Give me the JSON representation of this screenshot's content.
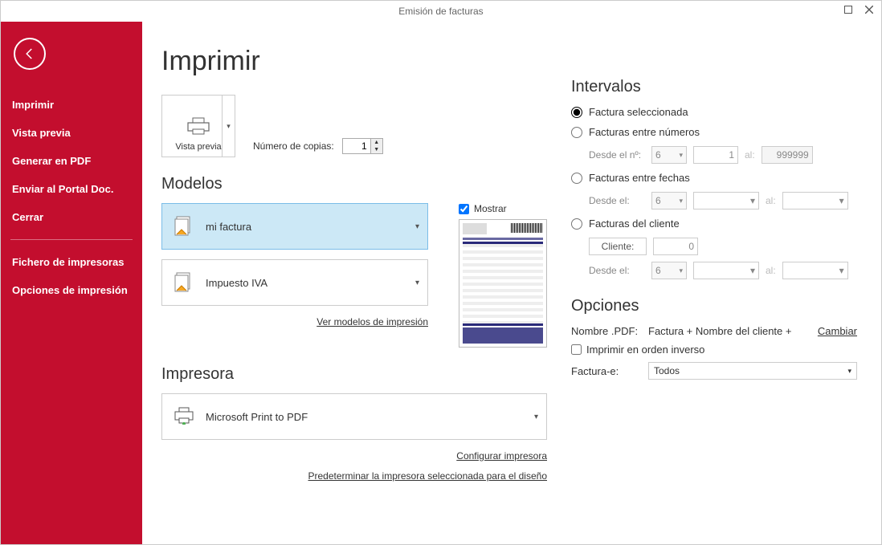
{
  "window": {
    "title": "Emisión de facturas"
  },
  "sidebar": {
    "items": [
      {
        "label": "Imprimir"
      },
      {
        "label": "Vista previa"
      },
      {
        "label": "Generar en PDF"
      },
      {
        "label": "Enviar al Portal Doc."
      },
      {
        "label": "Cerrar"
      }
    ],
    "items2": [
      {
        "label": "Fichero de impresoras"
      },
      {
        "label": "Opciones de impresión"
      }
    ]
  },
  "page": {
    "heading": "Imprimir",
    "vista_previa": "Vista previa",
    "copies_label": "Número de copias:",
    "copies_value": "1"
  },
  "modelos": {
    "heading": "Modelos",
    "show_label": "Mostrar",
    "items": [
      {
        "label": "mi factura"
      },
      {
        "label": "Impuesto IVA"
      }
    ],
    "link": "Ver modelos de impresión"
  },
  "impresora": {
    "heading": "Impresora",
    "item": "Microsoft Print to PDF",
    "link1": "Configurar impresora",
    "link2": "Predeterminar la impresora seleccionada para el diseño"
  },
  "intervalos": {
    "heading": "Intervalos",
    "radios": {
      "selected": "Factura seleccionada",
      "between_numbers": "Facturas entre números",
      "between_dates": "Facturas entre fechas",
      "client": "Facturas del cliente"
    },
    "labels": {
      "from_n": "Desde el nº:",
      "from": "Desde el:",
      "to": "al:",
      "client": "Cliente:"
    },
    "values": {
      "serie": "6",
      "num_from": "1",
      "num_to": "999999",
      "client_id": "0"
    }
  },
  "opciones": {
    "heading": "Opciones",
    "pdf_name_label": "Nombre .PDF:",
    "pdf_name_value": "Factura + Nombre del cliente +",
    "change_link": "Cambiar",
    "reverse_label": "Imprimir en orden inverso",
    "facturae_label": "Factura-e:",
    "facturae_value": "Todos"
  }
}
